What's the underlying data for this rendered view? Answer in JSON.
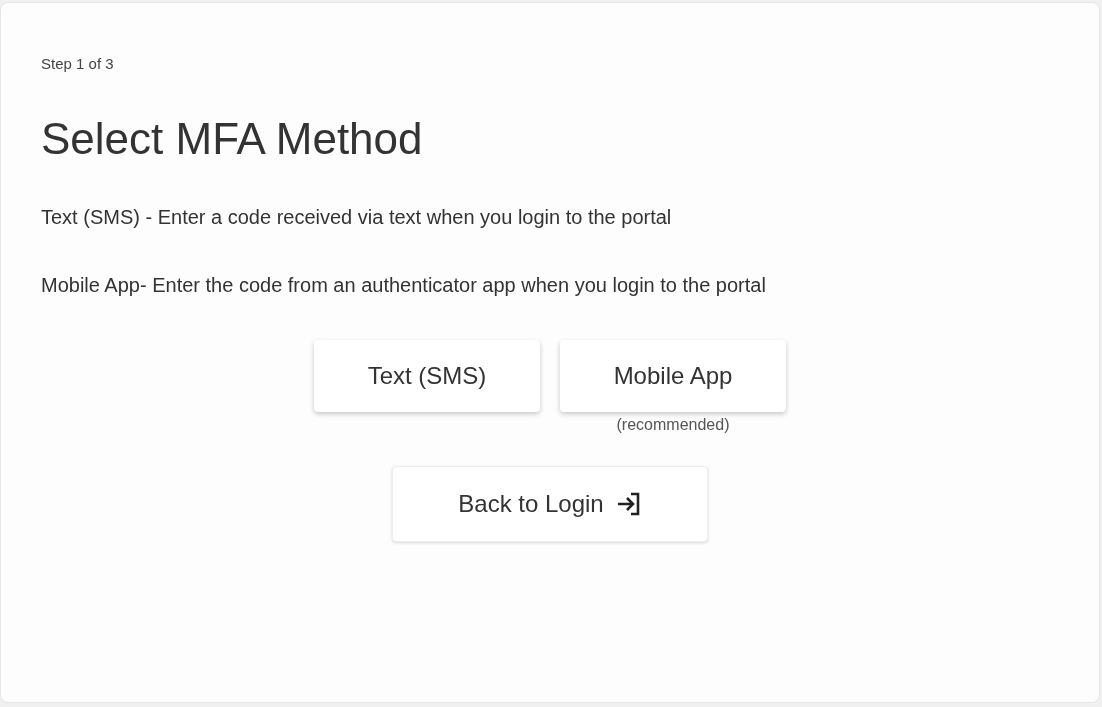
{
  "step": "Step 1 of 3",
  "title": "Select MFA Method",
  "descriptions": [
    "Text (SMS) - Enter a code received via text when you login to the portal",
    "Mobile App- Enter the code from an authenticator app when you login to the portal"
  ],
  "methods": [
    {
      "label": "Text (SMS)"
    },
    {
      "label": "Mobile App",
      "note": "(recommended)"
    }
  ],
  "back_button": {
    "label": "Back to Login"
  }
}
